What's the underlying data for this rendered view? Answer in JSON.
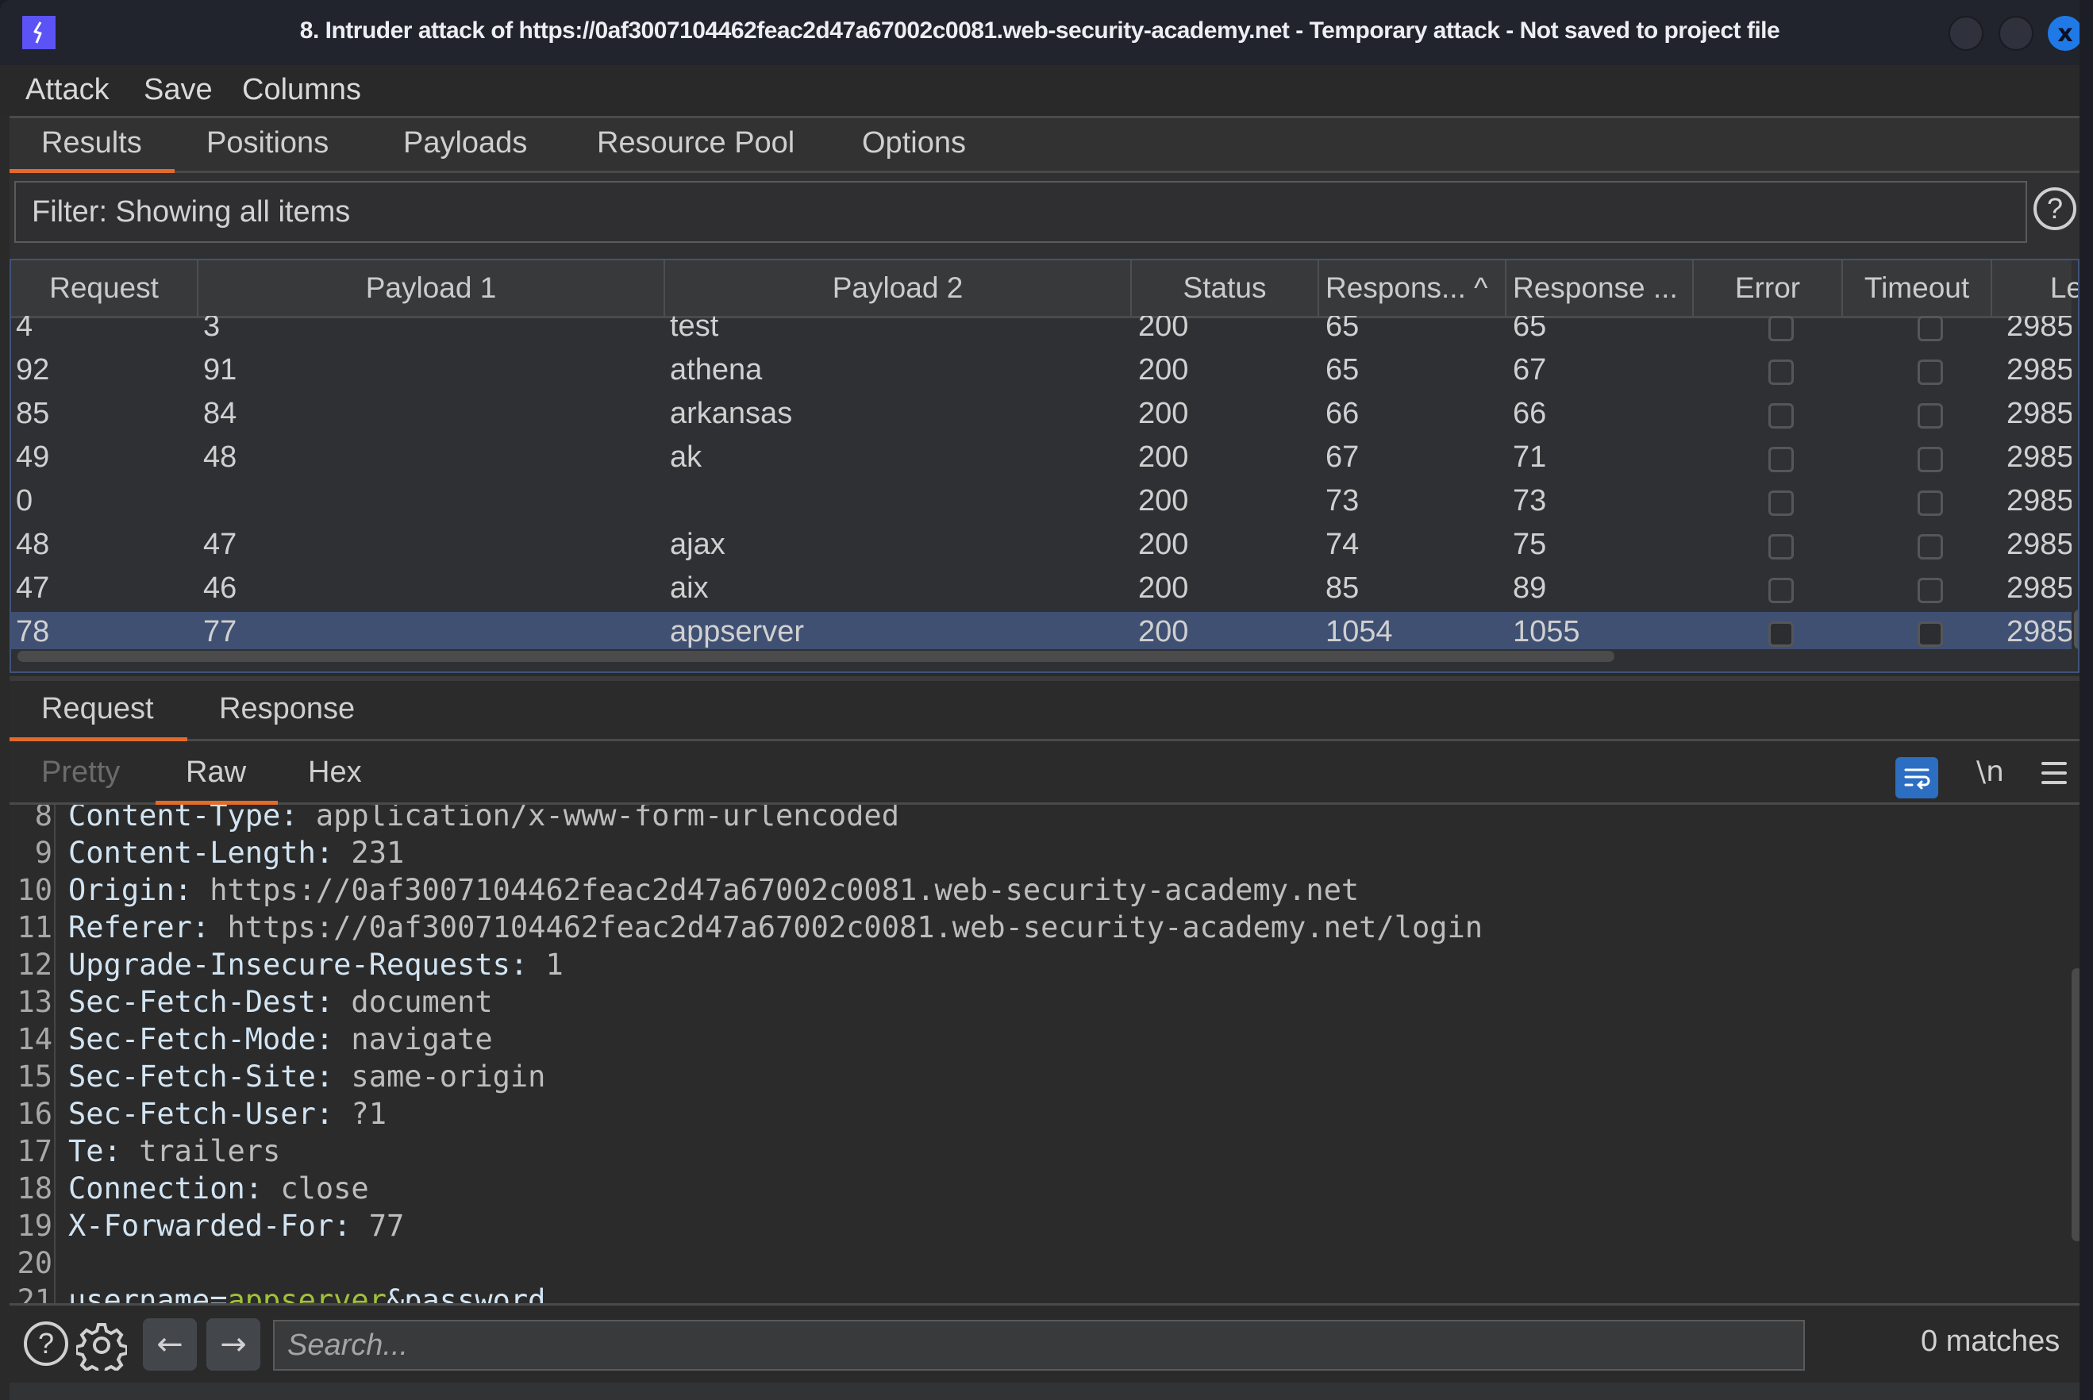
{
  "window": {
    "title": "8. Intruder attack of https://0af3007104462feac2d47a67002c0081.web-security-academy.net - Temporary attack - Not saved to project file",
    "logo_icon": "burp-lightning-icon",
    "close_glyph": "x",
    "accent_color": "#5b53f5"
  },
  "menu": {
    "items": [
      "Attack",
      "Save",
      "Columns"
    ]
  },
  "main_tabs": {
    "items": [
      "Results",
      "Positions",
      "Payloads",
      "Resource Pool",
      "Options"
    ],
    "active": "Results"
  },
  "filter": {
    "text": "Filter: Showing all items",
    "help_glyph": "?"
  },
  "table": {
    "columns": [
      "Request",
      "Payload 1",
      "Payload 2",
      "Status",
      "Respons... ^",
      "Response ...",
      "Error",
      "Timeout",
      "Le"
    ],
    "rows": [
      {
        "request": "4",
        "payload1": "3",
        "payload2": "test",
        "status": "200",
        "resp1": "65",
        "resp2": "65",
        "error": false,
        "timeout": false,
        "length": "2985",
        "selected": false
      },
      {
        "request": "92",
        "payload1": "91",
        "payload2": "athena",
        "status": "200",
        "resp1": "65",
        "resp2": "67",
        "error": false,
        "timeout": false,
        "length": "2985",
        "selected": false
      },
      {
        "request": "85",
        "payload1": "84",
        "payload2": "arkansas",
        "status": "200",
        "resp1": "66",
        "resp2": "66",
        "error": false,
        "timeout": false,
        "length": "2985",
        "selected": false
      },
      {
        "request": "49",
        "payload1": "48",
        "payload2": "ak",
        "status": "200",
        "resp1": "67",
        "resp2": "71",
        "error": false,
        "timeout": false,
        "length": "2985",
        "selected": false
      },
      {
        "request": "0",
        "payload1": "",
        "payload2": "",
        "status": "200",
        "resp1": "73",
        "resp2": "73",
        "error": false,
        "timeout": false,
        "length": "2985",
        "selected": false
      },
      {
        "request": "48",
        "payload1": "47",
        "payload2": "ajax",
        "status": "200",
        "resp1": "74",
        "resp2": "75",
        "error": false,
        "timeout": false,
        "length": "2985",
        "selected": false
      },
      {
        "request": "47",
        "payload1": "46",
        "payload2": "aix",
        "status": "200",
        "resp1": "85",
        "resp2": "89",
        "error": false,
        "timeout": false,
        "length": "2985",
        "selected": false
      },
      {
        "request": "78",
        "payload1": "77",
        "payload2": "appserver",
        "status": "200",
        "resp1": "1054",
        "resp2": "1055",
        "error": false,
        "timeout": false,
        "length": "2985",
        "selected": true
      }
    ],
    "selected_row_color": "#3f5073"
  },
  "detail_tabs": {
    "items": [
      "Request",
      "Response"
    ],
    "active": "Request"
  },
  "view_tabs": {
    "items": [
      "Pretty",
      "Raw",
      "Hex"
    ],
    "active": "Raw",
    "wrap_icon": "word-wrap-icon",
    "newline_label": "\\n",
    "menu_icon": "hamburger-menu-icon"
  },
  "editor": {
    "lines": [
      {
        "n": "8",
        "name": "Content-Type:",
        "value": " application/x-www-form-urlencoded"
      },
      {
        "n": "9",
        "name": "Content-Length:",
        "value": " 231"
      },
      {
        "n": "10",
        "name": "Origin:",
        "value": " https://0af3007104462feac2d47a67002c0081.web-security-academy.net"
      },
      {
        "n": "11",
        "name": "Referer:",
        "value": " https://0af3007104462feac2d47a67002c0081.web-security-academy.net/login"
      },
      {
        "n": "12",
        "name": "Upgrade-Insecure-Requests:",
        "value": " 1"
      },
      {
        "n": "13",
        "name": "Sec-Fetch-Dest:",
        "value": " document"
      },
      {
        "n": "14",
        "name": "Sec-Fetch-Mode:",
        "value": " navigate"
      },
      {
        "n": "15",
        "name": "Sec-Fetch-Site:",
        "value": " same-origin"
      },
      {
        "n": "16",
        "name": "Sec-Fetch-User:",
        "value": " ?1"
      },
      {
        "n": "17",
        "name": "Te:",
        "value": " trailers"
      },
      {
        "n": "18",
        "name": "Connection:",
        "value": " close"
      },
      {
        "n": "19",
        "name": "X-Forwarded-For:",
        "value": " 77"
      },
      {
        "n": "20",
        "name": "",
        "value": ""
      }
    ],
    "body_line": {
      "n": "21",
      "prefix": "username=",
      "payload": "appserver",
      "suffix": "&password"
    }
  },
  "bottom": {
    "search_placeholder": "Search...",
    "matches": "0 matches",
    "help_glyph": "?",
    "back_glyph": "←",
    "forward_glyph": "→"
  }
}
